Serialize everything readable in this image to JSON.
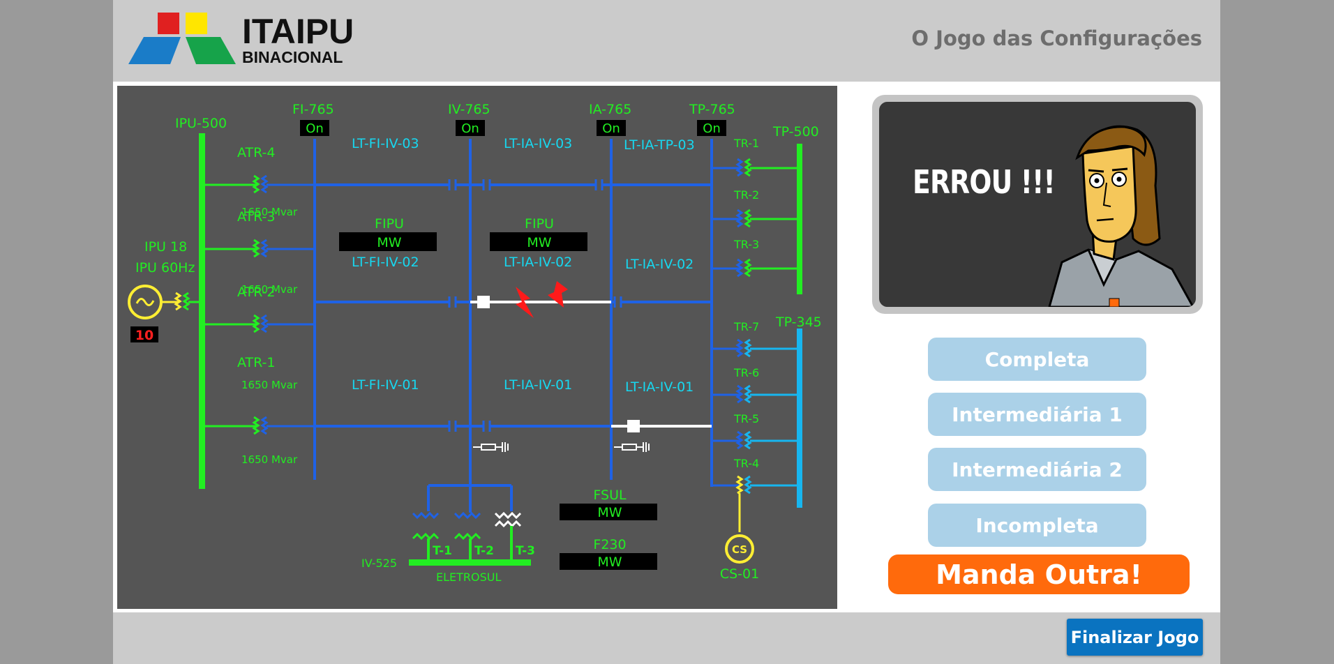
{
  "brand": {
    "name": "ITAIPU",
    "subtitle": "BINACIONAL"
  },
  "header": {
    "title": "O Jogo das Configurações"
  },
  "diagram": {
    "generator": {
      "label1": "IPU 18",
      "label2": "IPU 60Hz",
      "count": "10"
    },
    "buses": {
      "ipu500": "IPU-500",
      "fi765": "FI-765",
      "iv765": "IV-765",
      "ia765": "IA-765",
      "tp765": "TP-765",
      "tp500": "TP-500",
      "tp345": "TP-345",
      "iv525": "IV-525",
      "eletrosul": "ELETROSUL"
    },
    "status": {
      "fi765": "On",
      "iv765": "On",
      "ia765": "On",
      "tp765": "On"
    },
    "transformers": {
      "atr4": "ATR-4",
      "atr3": "ATR-3",
      "atr2": "ATR-2",
      "atr1": "ATR-1",
      "mvar": "1650 Mvar",
      "tr1": "TR-1",
      "tr2": "TR-2",
      "tr3": "TR-3",
      "tr7": "TR-7",
      "tr6": "TR-6",
      "tr5": "TR-5",
      "tr4": "TR-4",
      "t1": "T-1",
      "t2": "T-2",
      "t3": "T-3"
    },
    "lines": {
      "fi_iv_03": "LT-FI-IV-03",
      "ia_iv_03": "LT-IA-IV-03",
      "ia_tp_03": "LT-IA-TP-03",
      "fi_iv_02": "LT-FI-IV-02",
      "ia_iv_02a": "LT-IA-IV-02",
      "ia_iv_02b": "LT-IA-IV-02",
      "fi_iv_01": "LT-FI-IV-01",
      "ia_iv_01a": "LT-IA-IV-01",
      "ia_iv_01b": "LT-IA-IV-01"
    },
    "flows": {
      "fipu1": {
        "label": "FIPU",
        "unit": "MW"
      },
      "fipu2": {
        "label": "FIPU",
        "unit": "MW"
      },
      "fsul": {
        "label": "FSUL",
        "unit": "MW"
      },
      "f230": {
        "label": "F230",
        "unit": "MW"
      }
    },
    "cs": {
      "symbol": "CS",
      "label": "CS-01"
    }
  },
  "feedback": {
    "text": "ERROU !!!"
  },
  "options": [
    "Completa",
    "Intermediária 1",
    "Intermediária 2",
    "Incompleta"
  ],
  "next_label": "Manda Outra!",
  "finish_label": "Finalizar Jogo",
  "colors": {
    "bus_green": "#22ee22",
    "line_blue": "#1f62e6",
    "cyan": "#17b6f0",
    "yellow": "#ffee33",
    "fault_red": "#ff1a1a",
    "next_orange": "#ff6a0c",
    "finish_blue": "#0a73c0",
    "option_blue": "#abd1e8"
  }
}
